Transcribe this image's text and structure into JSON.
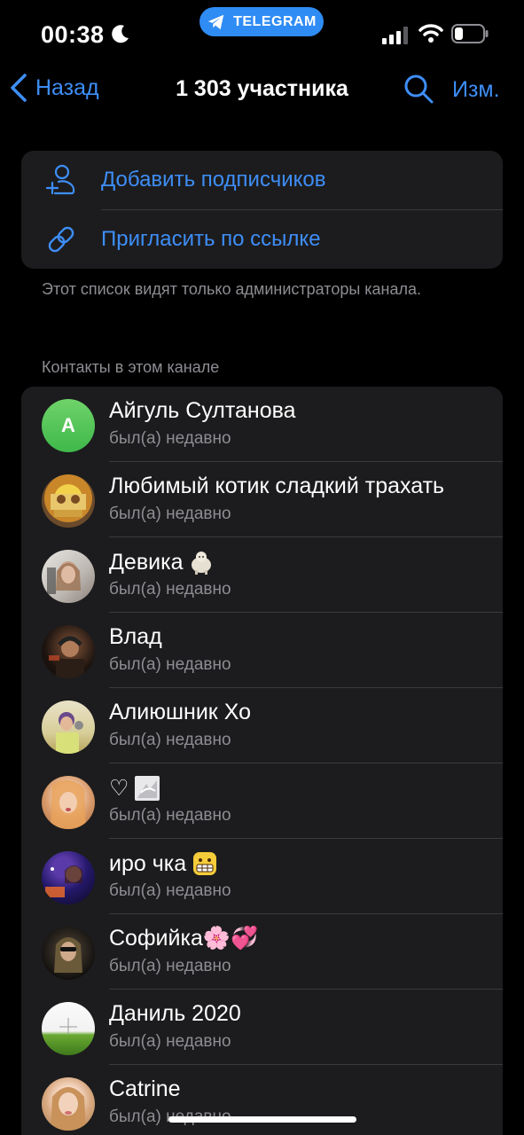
{
  "status_bar": {
    "time": "00:38",
    "app_pill": "TELEGRAM",
    "icons": [
      "moon-icon",
      "telegram-icon",
      "signal-icon",
      "wifi-icon",
      "battery-icon"
    ]
  },
  "nav": {
    "back_label": "Назад",
    "title": "1 303 участника",
    "edit_label": "Изм."
  },
  "actions": [
    {
      "label": "Добавить подписчиков",
      "icon": "add-user-icon"
    },
    {
      "label": "Пригласить по ссылке",
      "icon": "link-icon"
    }
  ],
  "hint": "Этот список видят только администраторы канала.",
  "section_header": "Контакты в этом канале",
  "contacts": [
    {
      "name": "Айгуль Султанова",
      "status": "был(а) недавно",
      "avatar_letter": "А"
    },
    {
      "name": "Любимый котик сладкий трахать",
      "status": "был(а) недавно"
    },
    {
      "name": "Девика",
      "status": "был(а) недавно"
    },
    {
      "name": "Влад",
      "status": "был(а) недавно"
    },
    {
      "name": "Алиюшник Хо",
      "status": "был(а) недавно"
    },
    {
      "name": "♡",
      "status": "был(а) недавно"
    },
    {
      "name": "иро чка",
      "status": "был(а) недавно"
    },
    {
      "name": "Софийка🌸💞",
      "status": "был(а) недавно"
    },
    {
      "name": "Даниль 2020",
      "status": "был(а) недавно"
    },
    {
      "name": "Catrine",
      "status": "был(а) недавно"
    }
  ],
  "colors": {
    "accent": "#3e8ef7",
    "background": "#000000",
    "card": "#1c1c1e",
    "secondary_text": "#8d8d93",
    "telegram_pill": "#2f8cf5"
  }
}
